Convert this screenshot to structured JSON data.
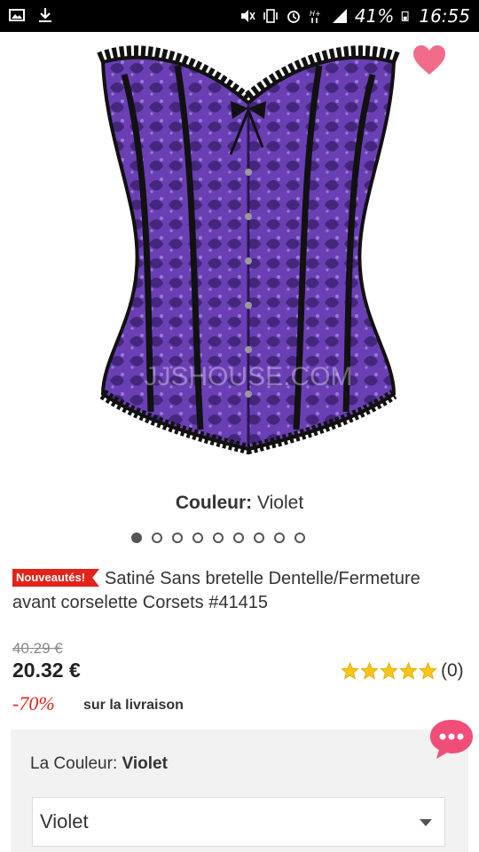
{
  "status_bar": {
    "battery": "41%",
    "time": "16:55",
    "icons": [
      "image-icon",
      "download-icon",
      "mute-icon",
      "vibrate-icon",
      "alarm-icon",
      "signal-hplus-icon",
      "signal-bars-icon",
      "battery-icon"
    ]
  },
  "product": {
    "image_watermark": "JJSHOUSE.COM",
    "color_caption_label": "Couleur:",
    "color_caption_value": "Violet",
    "gallery_count": 9,
    "gallery_active_index": 0,
    "badge": "Nouveautés!",
    "title": "Satiné Sans bretelle Dentelle/Fermeture avant corselette Corsets #41415",
    "old_price": "40.29 €",
    "price": "20.32 €",
    "rating_stars": 5,
    "review_count": "(0)",
    "discount": "-70%",
    "shipping_note": "sur la livraison"
  },
  "options": {
    "color_label": "La Couleur:",
    "color_value": "Violet",
    "select_value": "Violet"
  },
  "colors": {
    "accent_red": "#e2231a",
    "wishlist_pink": "#f26b8a",
    "chat_pink": "#f04e78",
    "star_gold": "#f5c518",
    "corset_purple": "#6a3fb4"
  }
}
